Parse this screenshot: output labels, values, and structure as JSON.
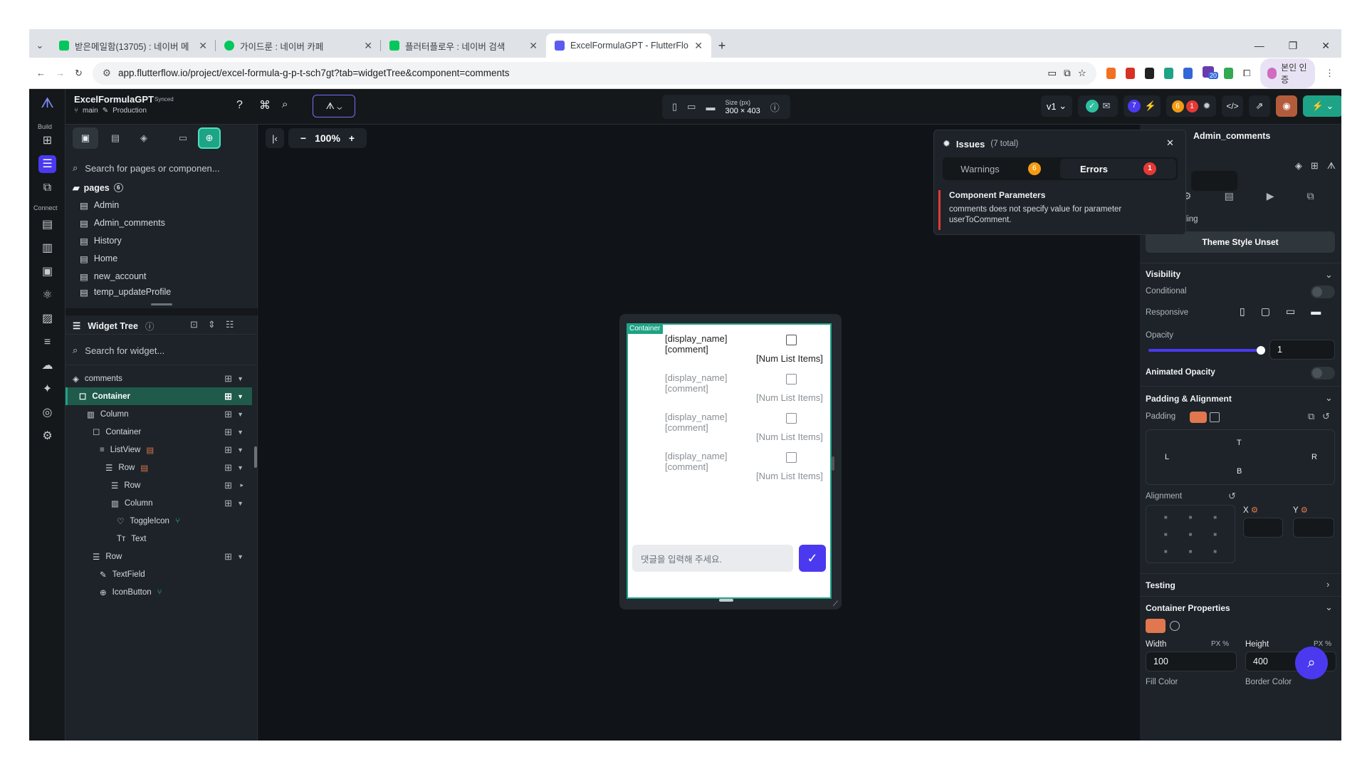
{
  "browser": {
    "tabs": [
      {
        "label": "받은메일함(13705) : 네이버 메",
        "color": "#03c75a"
      },
      {
        "label": "가이드룬 : 네이버 카페",
        "color": "#03c75a"
      },
      {
        "label": "플러터플로우 : 네이버 검색",
        "color": "#03c75a"
      },
      {
        "label": "ExcelFormulaGPT - FlutterFlow",
        "color": "#5b5bf0"
      }
    ],
    "new_tab": "+",
    "url": "app.flutterflow.io/project/excel-formula-g-p-t-sch7gt?tab=widgetTree&component=comments",
    "profile_label": "본인 인증",
    "ext_badge": "20"
  },
  "header": {
    "project_name": "ExcelFormulaGPT",
    "synced": "Synced",
    "branch": "main",
    "env": "Production",
    "size_label": "Size (px)",
    "size_value": "300 × 403",
    "version": "v1",
    "badge_blue": "7",
    "badge_orange": "6",
    "badge_red": "1"
  },
  "rail": {
    "build_label": "Build",
    "connect_label": "Connect"
  },
  "left_panel": {
    "search_placeholder": "Search for pages or componen...",
    "pages_title": "pages",
    "pages_count": "6",
    "pages": [
      "Admin",
      "Admin_comments",
      "History",
      "Home",
      "new_account",
      "temp_updateProfile"
    ],
    "widget_tree_title": "Widget Tree",
    "widget_search_placeholder": "Search for widget...",
    "tree": [
      {
        "label": "comments",
        "depth": 0
      },
      {
        "label": "Container",
        "depth": 0
      },
      {
        "label": "Column",
        "depth": 1
      },
      {
        "label": "Container",
        "depth": 2
      },
      {
        "label": "ListView",
        "depth": 3
      },
      {
        "label": "Row",
        "depth": 4
      },
      {
        "label": "Row",
        "depth": 5
      },
      {
        "label": "Column",
        "depth": 5
      },
      {
        "label": "ToggleIcon",
        "depth": 6
      },
      {
        "label": "Text",
        "depth": 6
      },
      {
        "label": "Row",
        "depth": 2
      },
      {
        "label": "TextField",
        "depth": 3
      },
      {
        "label": "IconButton",
        "depth": 3
      }
    ]
  },
  "canvas": {
    "zoom": "100%",
    "container_tag": "Container",
    "list_items": [
      {
        "name": "[display_name]",
        "comment": "[comment]",
        "num": "[Num List Items]"
      },
      {
        "name": "[display_name]",
        "comment": "[comment]",
        "num": "[Num List Items]"
      },
      {
        "name": "[display_name]",
        "comment": "[comment]",
        "num": "[Num List Items]"
      },
      {
        "name": "[display_name]",
        "comment": "[comment]",
        "num": "[Num List Items]"
      }
    ],
    "input_placeholder": "댓글을 입력해 주세요."
  },
  "issues": {
    "title": "Issues",
    "total": "(7 total)",
    "warnings_label": "Warnings",
    "warnings_count": "6",
    "errors_label": "Errors",
    "errors_count": "1",
    "item_title": "Component Parameters",
    "item_desc": "comments does not specify value for parameter userToComment."
  },
  "right_panel": {
    "page_name": "Admin_comments",
    "widget_styling": "Widget Styling",
    "theme_style": "Theme Style Unset",
    "visibility": "Visibility",
    "conditional": "Conditional",
    "responsive": "Responsive",
    "opacity": "Opacity",
    "opacity_value": "1",
    "opacity_level": 1,
    "animated_opacity": "Animated Opacity",
    "padding_alignment": "Padding & Alignment",
    "padding": "Padding",
    "pad_T": "T",
    "pad_L": "L",
    "pad_R": "R",
    "pad_B": "B",
    "alignment": "Alignment",
    "x_label": "X",
    "y_label": "Y",
    "testing": "Testing",
    "container_properties": "Container Properties",
    "width_label": "Width",
    "width_unit": "PX %",
    "width_value": "100",
    "height_label": "Height",
    "height_unit": "PX %",
    "height_value": "400",
    "fill_color": "Fill Color",
    "border_color": "Border Color"
  }
}
